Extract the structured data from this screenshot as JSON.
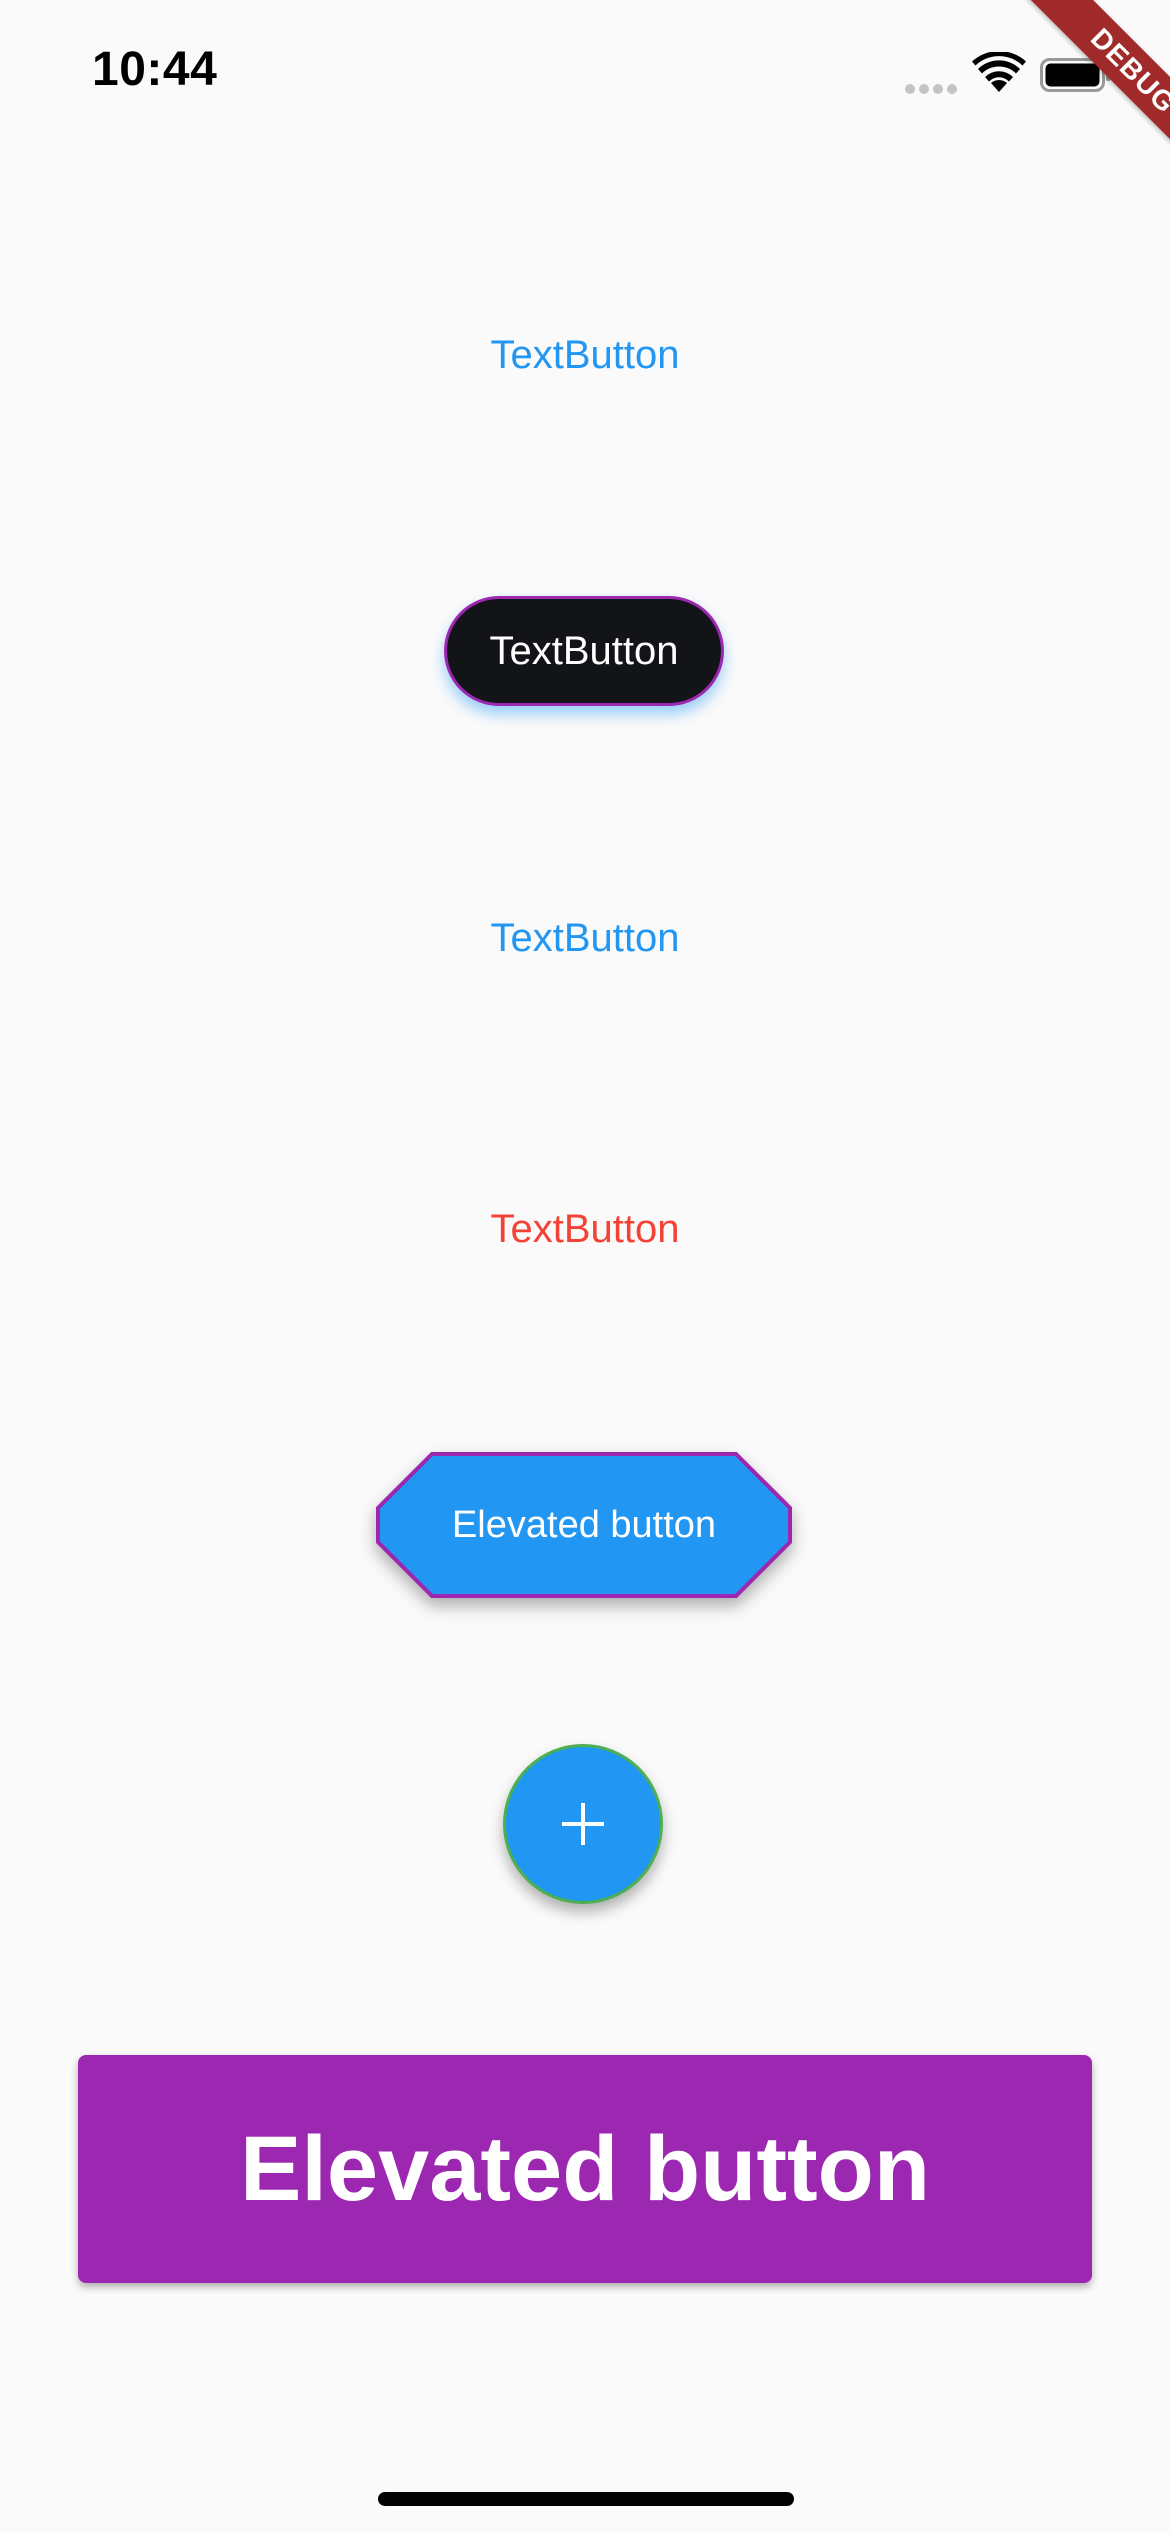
{
  "status_bar": {
    "time": "10:44",
    "signal_icon": "signal-dots-icon",
    "wifi_icon": "wifi-icon",
    "battery_icon": "battery-icon"
  },
  "debug_banner": {
    "label": "DEBUG",
    "color": "#a12a2a"
  },
  "buttons": {
    "text_button_1": {
      "label": "TextButton",
      "color": "#2196f3"
    },
    "text_button_2": {
      "label": "TextButton",
      "background": "#121418",
      "border_color": "#9c27b0"
    },
    "text_button_3": {
      "label": "TextButton",
      "color": "#2196f3"
    },
    "text_button_4": {
      "label": "TextButton",
      "color": "#f44336"
    },
    "elevated_octagon": {
      "label": "Elevated button",
      "background": "#2196f3",
      "border_color": "#9c27b0"
    },
    "fab": {
      "icon": "plus-icon",
      "background": "#2196f3",
      "border_color": "#4caf50"
    },
    "elevated_large": {
      "label": "Elevated button",
      "background": "#9c27b0"
    }
  }
}
